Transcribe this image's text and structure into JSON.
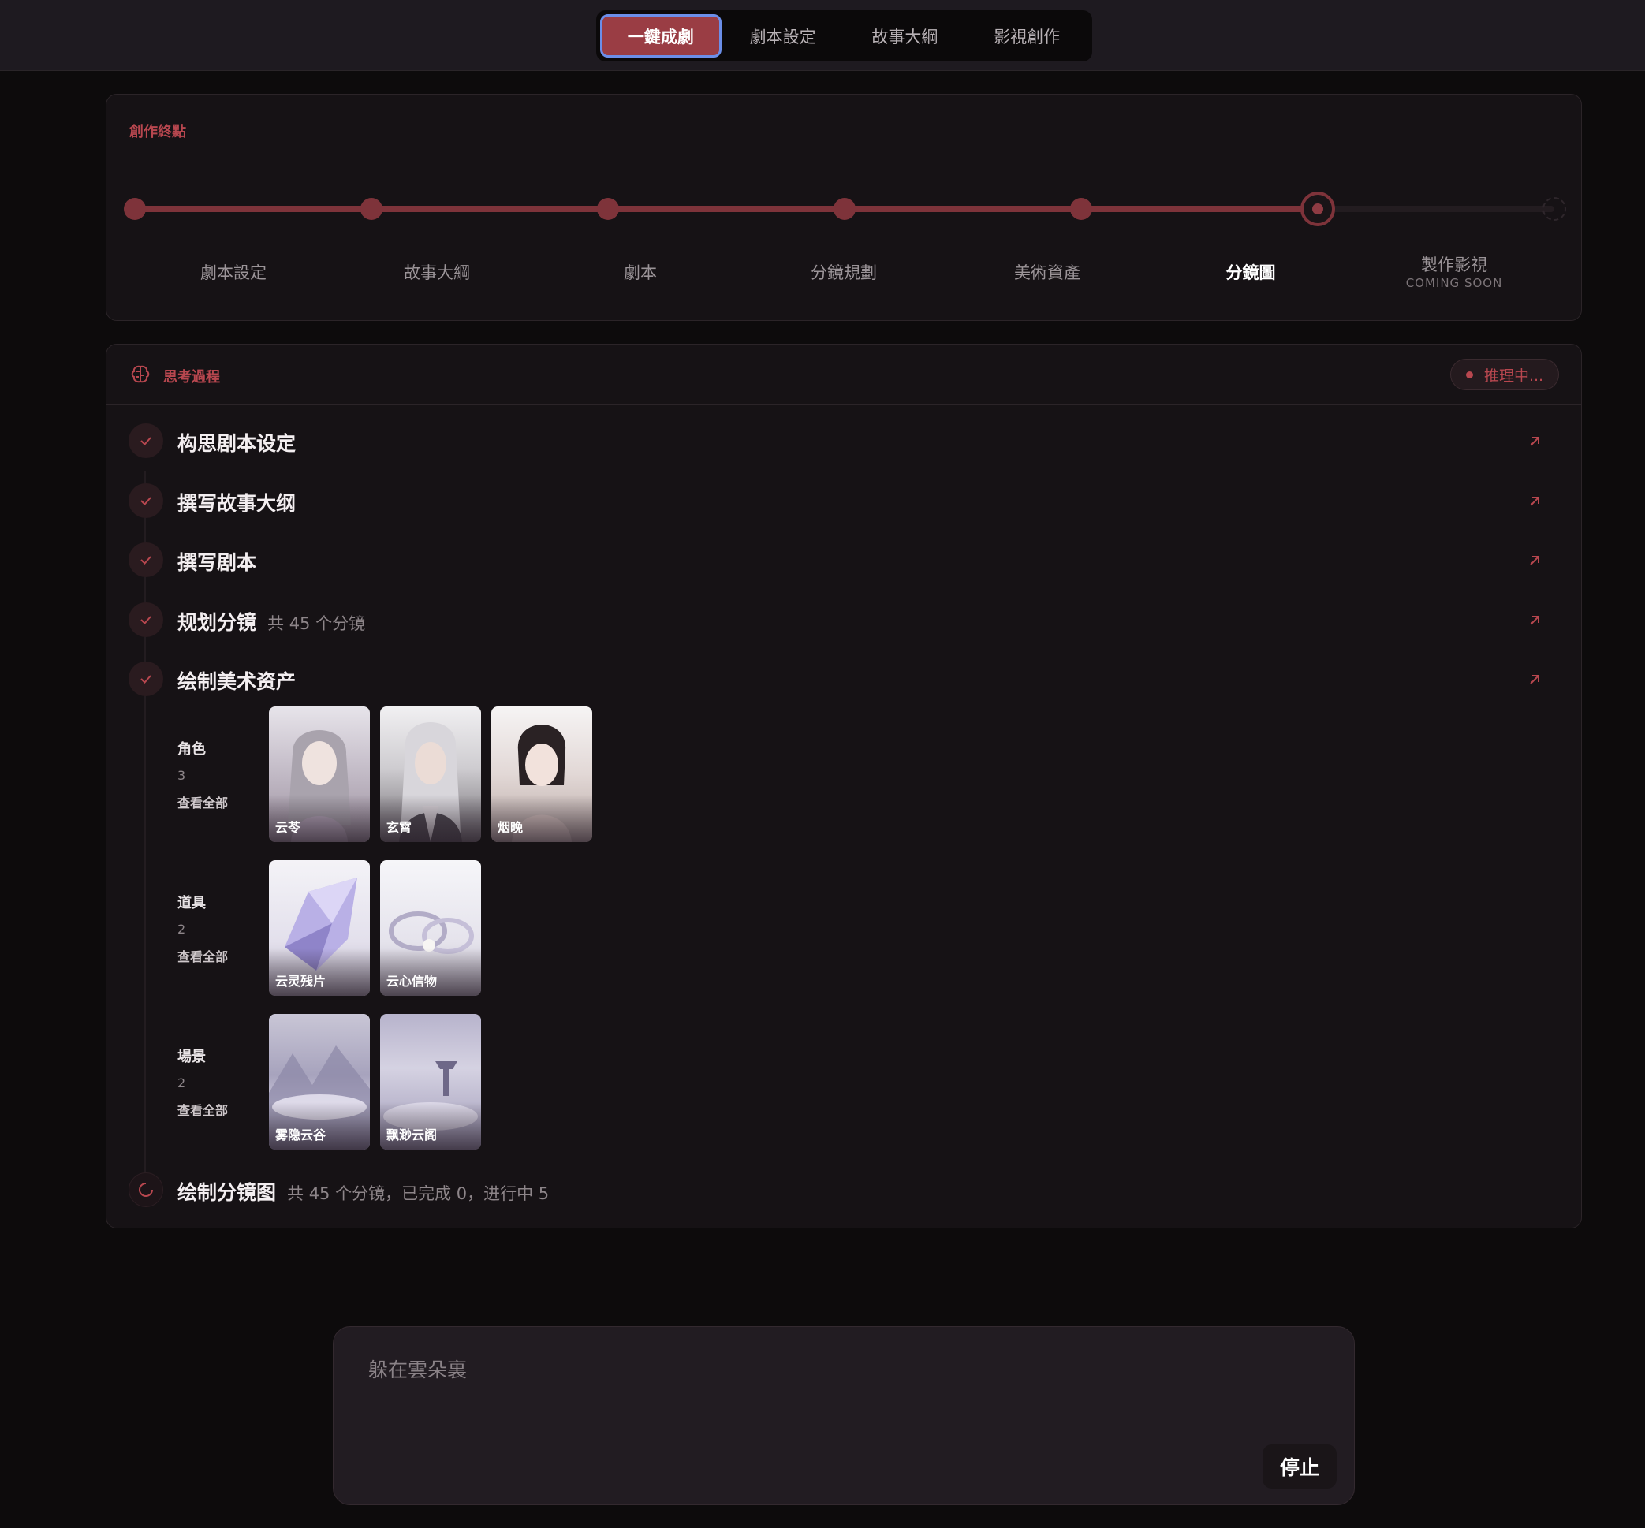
{
  "nav": {
    "tabs": [
      {
        "label": "一鍵成劇",
        "active": true
      },
      {
        "label": "劇本設定",
        "active": false
      },
      {
        "label": "故事大綱",
        "active": false
      },
      {
        "label": "影視創作",
        "active": false
      }
    ]
  },
  "progress": {
    "title": "創作終點",
    "steps": [
      {
        "label": "劇本設定",
        "state": "done"
      },
      {
        "label": "故事大綱",
        "state": "done"
      },
      {
        "label": "劇本",
        "state": "done"
      },
      {
        "label": "分鏡規劃",
        "state": "done"
      },
      {
        "label": "美術資產",
        "state": "done"
      },
      {
        "label": "分鏡圖",
        "state": "current"
      },
      {
        "label": "製作影視",
        "sublabel": "COMING SOON",
        "state": "pending"
      }
    ]
  },
  "thinking": {
    "title": "思考過程",
    "status": "推理中...",
    "tasks": [
      {
        "title": "构思剧本设定",
        "meta": "",
        "state": "done"
      },
      {
        "title": "撰写故事大纲",
        "meta": "",
        "state": "done"
      },
      {
        "title": "撰写剧本",
        "meta": "",
        "state": "done"
      },
      {
        "title": "规划分镜",
        "meta": "共 45 个分镜",
        "state": "done"
      },
      {
        "title": "绘制美术资产",
        "meta": "",
        "state": "done"
      },
      {
        "title": "绘制分镜图",
        "meta": "共 45 个分镜，已完成 0，进行中 5",
        "state": "running"
      }
    ],
    "assets": [
      {
        "category": "角色",
        "count": "3",
        "view_all": "查看全部",
        "items": [
          "云苓",
          "玄霄",
          "烟晚"
        ]
      },
      {
        "category": "道具",
        "count": "2",
        "view_all": "查看全部",
        "items": [
          "云灵残片",
          "云心信物"
        ]
      },
      {
        "category": "場景",
        "count": "2",
        "view_all": "查看全部",
        "items": [
          "雾隐云谷",
          "飘渺云阁"
        ]
      }
    ]
  },
  "composer": {
    "value": "躲在雲朵裏",
    "stop_label": "停止"
  },
  "colors": {
    "accent": "#9a3d44",
    "accent_text": "#b8474f",
    "background": "#0d0b0c",
    "panel": "#161215"
  }
}
